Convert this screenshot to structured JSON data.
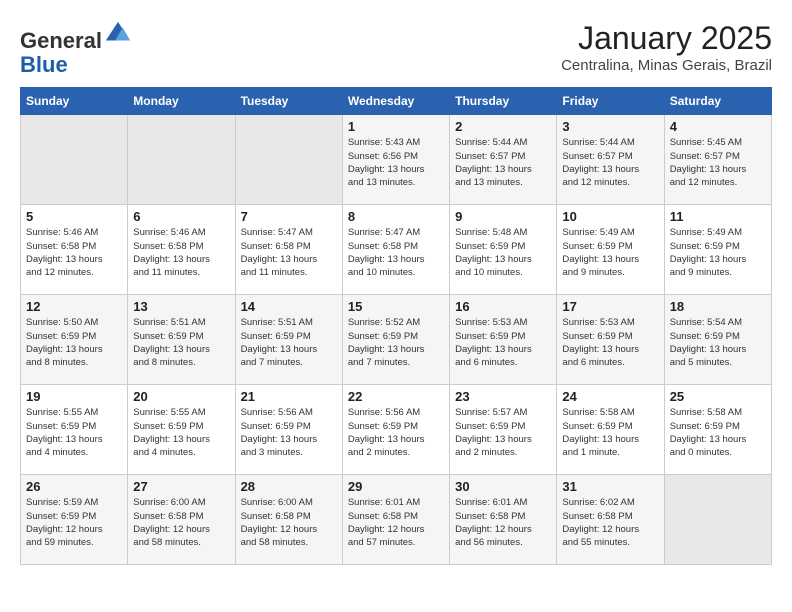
{
  "header": {
    "logo_general": "General",
    "logo_blue": "Blue",
    "month_title": "January 2025",
    "location": "Centralina, Minas Gerais, Brazil"
  },
  "weekdays": [
    "Sunday",
    "Monday",
    "Tuesday",
    "Wednesday",
    "Thursday",
    "Friday",
    "Saturday"
  ],
  "weeks": [
    [
      {
        "day": "",
        "info": ""
      },
      {
        "day": "",
        "info": ""
      },
      {
        "day": "",
        "info": ""
      },
      {
        "day": "1",
        "info": "Sunrise: 5:43 AM\nSunset: 6:56 PM\nDaylight: 13 hours\nand 13 minutes."
      },
      {
        "day": "2",
        "info": "Sunrise: 5:44 AM\nSunset: 6:57 PM\nDaylight: 13 hours\nand 13 minutes."
      },
      {
        "day": "3",
        "info": "Sunrise: 5:44 AM\nSunset: 6:57 PM\nDaylight: 13 hours\nand 12 minutes."
      },
      {
        "day": "4",
        "info": "Sunrise: 5:45 AM\nSunset: 6:57 PM\nDaylight: 13 hours\nand 12 minutes."
      }
    ],
    [
      {
        "day": "5",
        "info": "Sunrise: 5:46 AM\nSunset: 6:58 PM\nDaylight: 13 hours\nand 12 minutes."
      },
      {
        "day": "6",
        "info": "Sunrise: 5:46 AM\nSunset: 6:58 PM\nDaylight: 13 hours\nand 11 minutes."
      },
      {
        "day": "7",
        "info": "Sunrise: 5:47 AM\nSunset: 6:58 PM\nDaylight: 13 hours\nand 11 minutes."
      },
      {
        "day": "8",
        "info": "Sunrise: 5:47 AM\nSunset: 6:58 PM\nDaylight: 13 hours\nand 10 minutes."
      },
      {
        "day": "9",
        "info": "Sunrise: 5:48 AM\nSunset: 6:59 PM\nDaylight: 13 hours\nand 10 minutes."
      },
      {
        "day": "10",
        "info": "Sunrise: 5:49 AM\nSunset: 6:59 PM\nDaylight: 13 hours\nand 9 minutes."
      },
      {
        "day": "11",
        "info": "Sunrise: 5:49 AM\nSunset: 6:59 PM\nDaylight: 13 hours\nand 9 minutes."
      }
    ],
    [
      {
        "day": "12",
        "info": "Sunrise: 5:50 AM\nSunset: 6:59 PM\nDaylight: 13 hours\nand 8 minutes."
      },
      {
        "day": "13",
        "info": "Sunrise: 5:51 AM\nSunset: 6:59 PM\nDaylight: 13 hours\nand 8 minutes."
      },
      {
        "day": "14",
        "info": "Sunrise: 5:51 AM\nSunset: 6:59 PM\nDaylight: 13 hours\nand 7 minutes."
      },
      {
        "day": "15",
        "info": "Sunrise: 5:52 AM\nSunset: 6:59 PM\nDaylight: 13 hours\nand 7 minutes."
      },
      {
        "day": "16",
        "info": "Sunrise: 5:53 AM\nSunset: 6:59 PM\nDaylight: 13 hours\nand 6 minutes."
      },
      {
        "day": "17",
        "info": "Sunrise: 5:53 AM\nSunset: 6:59 PM\nDaylight: 13 hours\nand 6 minutes."
      },
      {
        "day": "18",
        "info": "Sunrise: 5:54 AM\nSunset: 6:59 PM\nDaylight: 13 hours\nand 5 minutes."
      }
    ],
    [
      {
        "day": "19",
        "info": "Sunrise: 5:55 AM\nSunset: 6:59 PM\nDaylight: 13 hours\nand 4 minutes."
      },
      {
        "day": "20",
        "info": "Sunrise: 5:55 AM\nSunset: 6:59 PM\nDaylight: 13 hours\nand 4 minutes."
      },
      {
        "day": "21",
        "info": "Sunrise: 5:56 AM\nSunset: 6:59 PM\nDaylight: 13 hours\nand 3 minutes."
      },
      {
        "day": "22",
        "info": "Sunrise: 5:56 AM\nSunset: 6:59 PM\nDaylight: 13 hours\nand 2 minutes."
      },
      {
        "day": "23",
        "info": "Sunrise: 5:57 AM\nSunset: 6:59 PM\nDaylight: 13 hours\nand 2 minutes."
      },
      {
        "day": "24",
        "info": "Sunrise: 5:58 AM\nSunset: 6:59 PM\nDaylight: 13 hours\nand 1 minute."
      },
      {
        "day": "25",
        "info": "Sunrise: 5:58 AM\nSunset: 6:59 PM\nDaylight: 13 hours\nand 0 minutes."
      }
    ],
    [
      {
        "day": "26",
        "info": "Sunrise: 5:59 AM\nSunset: 6:59 PM\nDaylight: 12 hours\nand 59 minutes."
      },
      {
        "day": "27",
        "info": "Sunrise: 6:00 AM\nSunset: 6:58 PM\nDaylight: 12 hours\nand 58 minutes."
      },
      {
        "day": "28",
        "info": "Sunrise: 6:00 AM\nSunset: 6:58 PM\nDaylight: 12 hours\nand 58 minutes."
      },
      {
        "day": "29",
        "info": "Sunrise: 6:01 AM\nSunset: 6:58 PM\nDaylight: 12 hours\nand 57 minutes."
      },
      {
        "day": "30",
        "info": "Sunrise: 6:01 AM\nSunset: 6:58 PM\nDaylight: 12 hours\nand 56 minutes."
      },
      {
        "day": "31",
        "info": "Sunrise: 6:02 AM\nSunset: 6:58 PM\nDaylight: 12 hours\nand 55 minutes."
      },
      {
        "day": "",
        "info": ""
      }
    ]
  ]
}
